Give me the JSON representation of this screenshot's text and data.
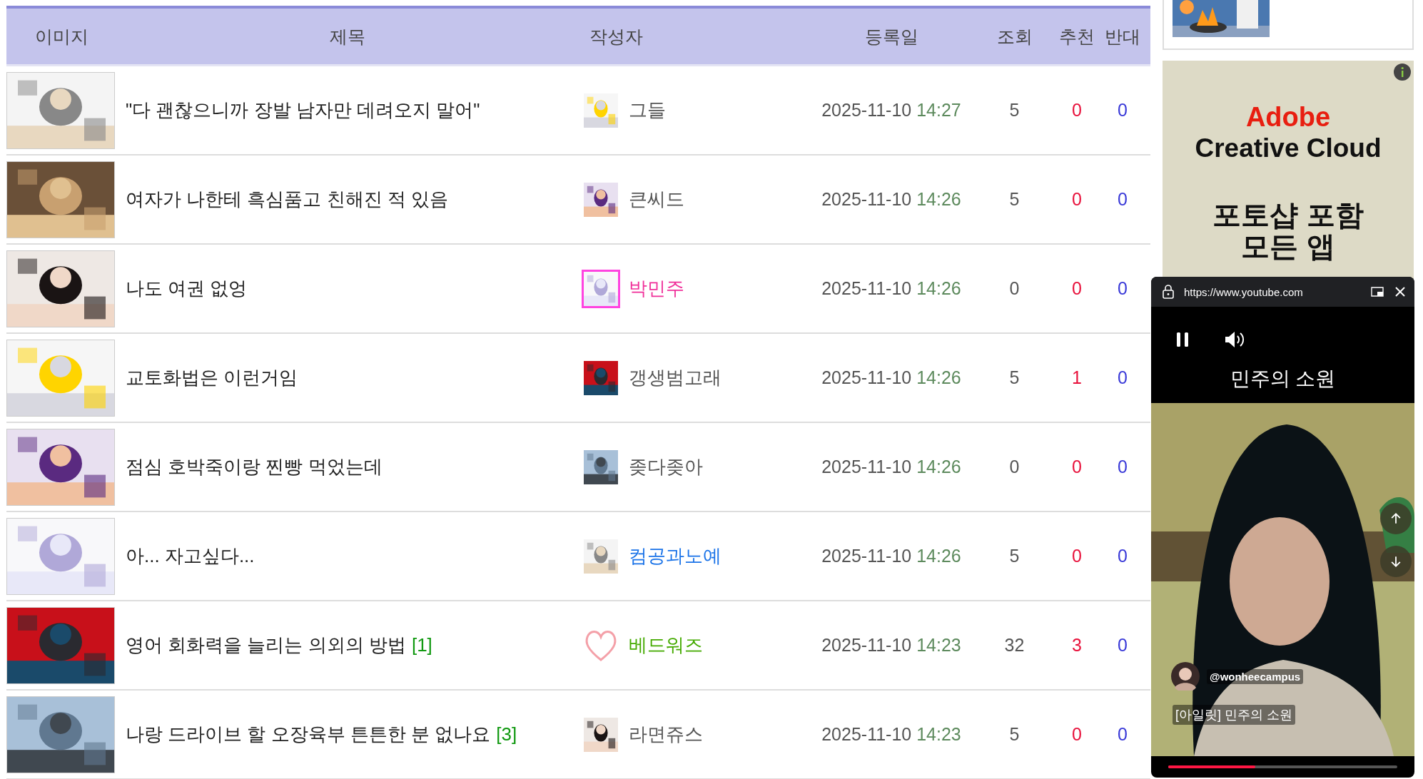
{
  "table": {
    "columns": [
      "이미지",
      "제목",
      "작성자",
      "등록일",
      "조회",
      "추천",
      "반대"
    ],
    "rows": [
      {
        "thumbnail": {
          "kind": "picture"
        },
        "title": "\"다 괜찮으니까 장발 남자만 데려오지 말어\"",
        "author": "그들",
        "color": "#555555",
        "avatar": {
          "kind": "picture",
          "framed": false
        },
        "date": "2025-11-10",
        "time": "14:27",
        "views": "5",
        "up": "0",
        "down": "0"
      },
      {
        "thumbnail": {
          "kind": "picture"
        },
        "title": "여자가 나한테 흑심품고 친해진 적 있음",
        "author": "큰씨드",
        "color": "#555555",
        "avatar": {
          "kind": "picture",
          "framed": false
        },
        "date": "2025-11-10",
        "time": "14:26",
        "views": "5",
        "up": "0",
        "down": "0"
      },
      {
        "thumbnail": {
          "kind": "picture"
        },
        "title": "나도 여권 없엉",
        "author": "박민주",
        "color": "#f0309a",
        "avatar": {
          "kind": "picture",
          "framed": true
        },
        "date": "2025-11-10",
        "time": "14:26",
        "views": "0",
        "up": "0",
        "down": "0"
      },
      {
        "thumbnail": {
          "kind": "picture"
        },
        "title": "교토화법은 이런거임",
        "author": "갱생범고래",
        "color": "#555555",
        "avatar": {
          "kind": "picture",
          "framed": false
        },
        "date": "2025-11-10",
        "time": "14:26",
        "views": "5",
        "up": "1",
        "down": "0"
      },
      {
        "thumbnail": {
          "kind": "picture"
        },
        "title": "점심 호박죽이랑 찐빵 먹었는데",
        "author": "좆다좆아",
        "color": "#555555",
        "avatar": {
          "kind": "picture",
          "framed": false
        },
        "date": "2025-11-10",
        "time": "14:26",
        "views": "0",
        "up": "0",
        "down": "0"
      },
      {
        "thumbnail": {
          "kind": "picture"
        },
        "title": "아... 자고싶다...",
        "author": "컴공과노예",
        "color": "#1a73e8",
        "avatar": {
          "kind": "picture",
          "framed": false
        },
        "date": "2025-11-10",
        "time": "14:26",
        "views": "5",
        "up": "0",
        "down": "0"
      },
      {
        "thumbnail": {
          "kind": "picture"
        },
        "title": "영어 회화력을 늘리는 의외의 방법",
        "comments": "[1]",
        "author": "베드워즈",
        "color": "#44aa00",
        "avatar": {
          "kind": "heart",
          "framed": false
        },
        "date": "2025-11-10",
        "time": "14:23",
        "views": "32",
        "up": "3",
        "down": "0"
      },
      {
        "thumbnail": {
          "kind": "picture"
        },
        "title": "나랑 드라이브 할 오장육부 튼튼한 분 없나요",
        "comments": "[3]",
        "author": "라면쥬스",
        "color": "#555555",
        "avatar": {
          "kind": "picture",
          "framed": false
        },
        "date": "2025-11-10",
        "time": "14:23",
        "views": "5",
        "up": "0",
        "down": "0"
      }
    ]
  },
  "side_widget": {
    "thumbnail": {
      "kind": "picture"
    }
  },
  "ad": {
    "brand": "Adobe",
    "product": "Creative Cloud",
    "headline": "포토샵 포함",
    "subline": "모든 앱"
  },
  "video_player": {
    "url": "https://www.youtube.com",
    "overlay_title": "민주의 소원",
    "channel": "@wonheecampus",
    "caption": "[아일릿] 민주의 소원",
    "playing": true,
    "progress": {
      "level": 0.38
    }
  }
}
